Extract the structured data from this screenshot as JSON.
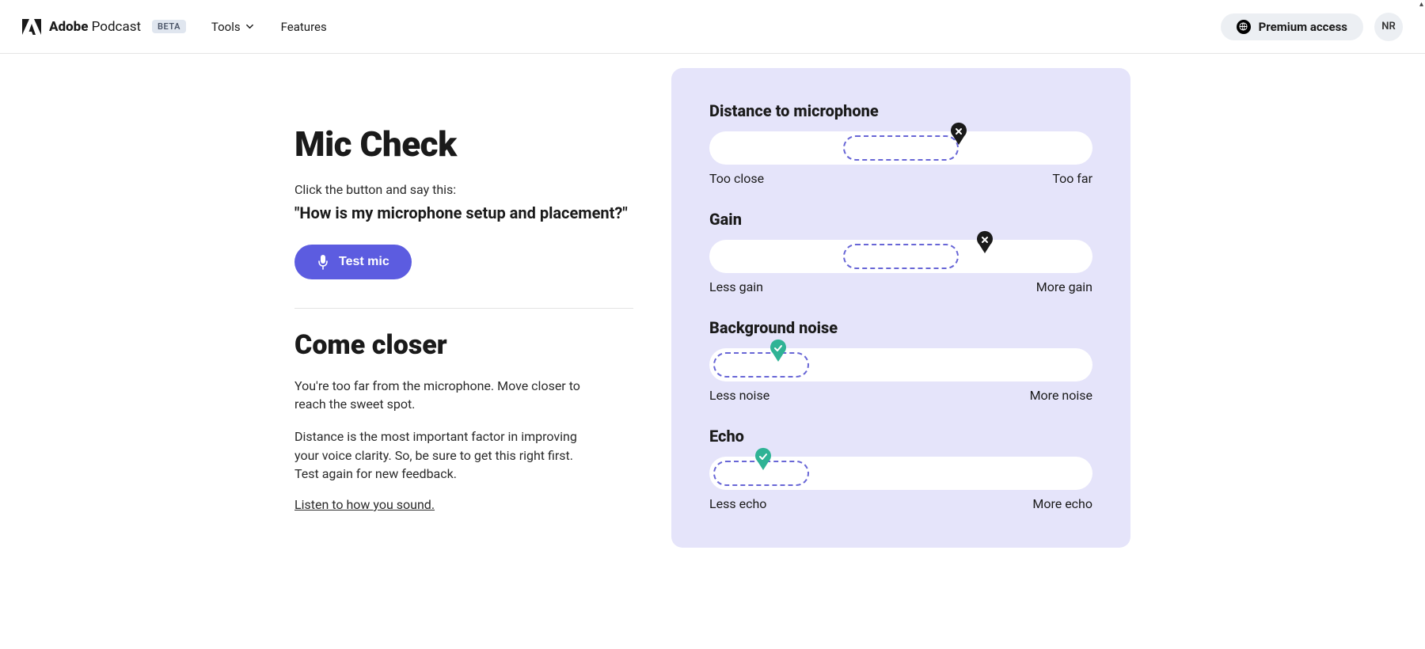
{
  "header": {
    "brand_bold": "Adobe",
    "brand_regular": "Podcast",
    "beta_label": "BETA",
    "nav": {
      "tools": "Tools",
      "features": "Features"
    },
    "premium_label": "Premium access",
    "avatar_initials": "NR"
  },
  "left": {
    "title": "Mic Check",
    "instruction": "Click the button and say this:",
    "quote": "\"How is my microphone setup and placement?\"",
    "test_button": "Test mic",
    "advice_heading": "Come closer",
    "advice_para1": "You're too far from the microphone. Move closer to reach the sweet spot.",
    "advice_para2": "Distance is the most important factor in improving your voice clarity. So, be sure to get this right first. Test again for new feedback.",
    "listen_link": "Listen to how you sound."
  },
  "metrics": [
    {
      "id": "distance",
      "title": "Distance to microphone",
      "left_label": "Too close",
      "right_label": "Too far",
      "target_start_pct": 35,
      "target_width_pct": 30,
      "marker_pct": 65,
      "status": "bad"
    },
    {
      "id": "gain",
      "title": "Gain",
      "left_label": "Less gain",
      "right_label": "More gain",
      "target_start_pct": 35,
      "target_width_pct": 30,
      "marker_pct": 72,
      "status": "bad"
    },
    {
      "id": "noise",
      "title": "Background noise",
      "left_label": "Less noise",
      "right_label": "More noise",
      "target_start_pct": 1,
      "target_width_pct": 25,
      "marker_pct": 18,
      "status": "good"
    },
    {
      "id": "echo",
      "title": "Echo",
      "left_label": "Less echo",
      "right_label": "More echo",
      "target_start_pct": 1,
      "target_width_pct": 25,
      "marker_pct": 14,
      "status": "good"
    }
  ],
  "colors": {
    "accent": "#5c5ce0",
    "card_bg": "#e5e4fa",
    "marker_bad": "#1a1a1a",
    "marker_good": "#2fb395"
  }
}
